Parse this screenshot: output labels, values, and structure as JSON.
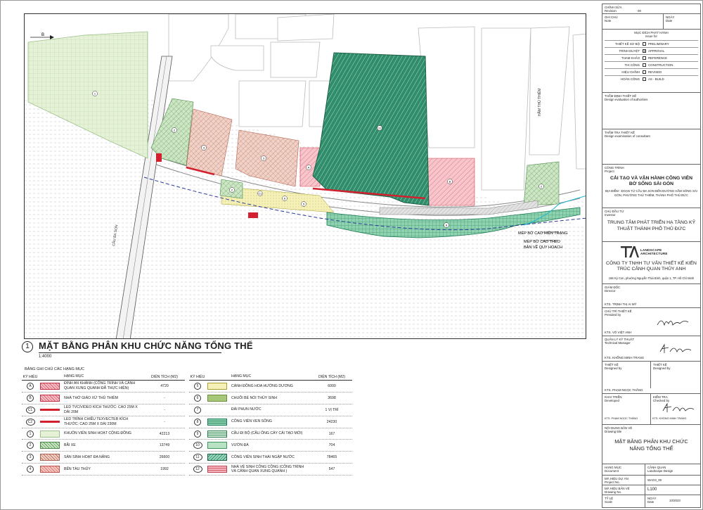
{
  "map": {
    "north_label": "B",
    "bridge_label": "CẦU BA SON",
    "street_label": "HẦM THỦ THIÊM",
    "callout_1": "MÉP BỜ CAO HIỆN TRẠNG",
    "callout_2": "MÉP BỜ CAO THEO BẢN VẼ QUY HOẠCH",
    "zone_numbers": [
      "1",
      "2",
      "3",
      "4",
      "5",
      "6",
      "7",
      "8",
      "9",
      "10",
      "11",
      "12",
      "A",
      "B"
    ]
  },
  "drawing_title": {
    "number": "1",
    "title": "MẶT BẰNG PHÂN KHU CHỨC NĂNG TỔNG THỂ",
    "scale": "1:4000"
  },
  "legend": {
    "title": "BẢNG GHI CHÚ CÁC HẠNG MỤC",
    "headers": {
      "symbol": "KÝ HIỆU",
      "item": "HẠNG MỤC",
      "area": "DIỆN TÍCH (M2)"
    },
    "left": [
      {
        "sym": "A",
        "name": "ĐÌNH AN KHÁNH (CÔNG TRÌNH VÀ CẢNH QUAN XUNG QUANH ĐÃ THỰC HIỆN)",
        "area": "4720",
        "swatch": "pink-hatch"
      },
      {
        "sym": "B",
        "name": "NHÀ THỜ GIÁO XỨ THỦ THIÊM",
        "area": "-",
        "swatch": "pink-hatch"
      },
      {
        "sym": "C1",
        "name": "LED TVC/VIDEO KÍCH THƯỚC: CAO 25M X DÀI 20M",
        "area": "-",
        "swatch": "red-bar"
      },
      {
        "sym": "C2",
        "name": "LED TRÌNH CHIẾU TEXVECTER KÍCH THƯỚC: CAO 25M X DÀI 230M",
        "area": "-",
        "swatch": "red-bar"
      },
      {
        "sym": "1",
        "name": "KHUÔN VIÊN SINH HOẠT CỘNG ĐỒNG",
        "area": "42213",
        "swatch": "light-green-grid"
      },
      {
        "sym": "2",
        "name": "BÃI XE",
        "area": "13749",
        "swatch": "green-hatch"
      },
      {
        "sym": "3",
        "name": "SÂN SINH HOẠT ĐA NĂNG",
        "area": "26600",
        "swatch": "brown-hatch"
      },
      {
        "sym": "4",
        "name": "BẾN TÀU THỦY",
        "area": "1992",
        "swatch": "salmon-hatch"
      }
    ],
    "right": [
      {
        "sym": "5",
        "name": "CÁNH ĐỒNG HOA HƯỚNG DƯƠNG",
        "area": "6000",
        "swatch": "yellow-dots"
      },
      {
        "sym": "6",
        "name": "CHUỖI BÈ NỔI THỦY SINH",
        "area": "3698",
        "swatch": "olive-green"
      },
      {
        "sym": "7",
        "name": "ĐÀI PHUN NƯỚC",
        "area": "1 VỊ TRÍ",
        "swatch": "none"
      },
      {
        "sym": "8",
        "name": "CÔNG VIÊN VEN SÔNG",
        "area": "24230",
        "swatch": "teal-grid"
      },
      {
        "sym": "9",
        "name": "CẦU ĐI BỘ (CẦU ỐNG CÂY CẢI TẠO MỚI)",
        "area": "167",
        "swatch": "green-lines"
      },
      {
        "sym": "10",
        "name": "VƯỜN ĐÁ",
        "area": "704",
        "swatch": "green-dots"
      },
      {
        "sym": "11",
        "name": "CÔNG VIÊN SINH THÁI NGẬP NƯỚC",
        "area": "78465",
        "swatch": "teal-hatch"
      },
      {
        "sym": "12",
        "name": "NHÀ VỆ SINH CÔNG CỘNG (CÔNG TRÌNH VÀ CẢNH QUAN XUNG QUANH )",
        "area": "547",
        "swatch": "pink-grid"
      }
    ]
  },
  "title_block": {
    "revision_vi": "CHỈNH SỬA",
    "revision_en": "Revision",
    "revision_no": "00",
    "note_vi": "GHI CHÚ",
    "note_en": "Note",
    "date_vi": "NGÀY",
    "date_en": "Date",
    "issue_vi": "MỤC ĐÍCH PHÁT HÀNH",
    "issue_en": "Issue for",
    "issue_rows": [
      {
        "vi": "THIẾT KẾ SƠ BỘ",
        "en": "PRELIMINARY",
        "checked": false
      },
      {
        "vi": "TRÌNH DUYỆT",
        "en": "APPROVAL",
        "checked": true
      },
      {
        "vi": "THAM KHẢO",
        "en": "REFERENCE",
        "checked": false
      },
      {
        "vi": "THI CÔNG",
        "en": "CONSTRUCTION",
        "checked": false
      },
      {
        "vi": "HIỆU CHỈNH",
        "en": "REVISED",
        "checked": false
      },
      {
        "vi": "HOÀN CÔNG",
        "en": "AS - BUILD",
        "checked": false
      }
    ],
    "appraisal_vi": "THẨM ĐỊNH THIẾT KẾ",
    "appraisal_en": "Design evaluation of authorities",
    "verification_vi": "THẨM TRA THIẾT KẾ",
    "verification_en": "Design examination of consultant",
    "project_vi": "CÔNG TRÌNH",
    "project_en": "Project",
    "project_name": "CẢI TẠO VÀ VẬN HÀNH CÔNG VIÊN BỜ SÔNG SÀI GÒN",
    "project_location": "ĐỊA ĐIỂM : ĐOẠN TỪ CẦU BA SON ĐẾN ĐƯỜNG HẦM SÔNG SÀI GÒN, PHƯỜNG THỦ THIÊM, THÀNH PHỐ THỦ ĐỨC",
    "investor_vi": "CHỦ ĐẦU TƯ",
    "investor_en": "Investor",
    "investor_name": "TRUNG TÂM PHÁT TRIỂN HẠ TẦNG KỸ THUẬT THÀNH PHỐ THỦ ĐỨC",
    "logo_text": "LANDSCAPE ARCHITECTURE",
    "company_name": "CÔNG TY TNHH TƯ VẤN THIẾT KẾ KIẾN TRÚC CẢNH QUAN THỦY ANH",
    "company_address": "166 Ký Con, phường Nguyễn Thái Bình, quận 1, TP. Hồ Chí Minh",
    "director_vi": "GIÁM ĐỐC",
    "director_en": "Director",
    "director_name": "KTS. TRỊNH THỊ AI MỸ",
    "chief_vi": "CHỦ TRÌ THIẾT KẾ",
    "chief_en": "Presided by",
    "chief_name": "KTS. VÕ VIỆT ANH",
    "tech_vi": "QUẢN LÝ KỸ THUẬT",
    "tech_en": "Technical Manager",
    "tech_name": "KTS. KHỔNG MINH TRANG",
    "design_vi": "THIẾT KẾ",
    "design_en": "Designed by",
    "design_name": "KTS. PHẠM NGỌC THẮNG",
    "developed_vi": "KHAI TRIỂN",
    "developed_en": "Developed",
    "developed_name": "KTS. PHẠM NGỌC THẮNG",
    "checked_vi": "KIỂM TRA",
    "checked_en": "Checked by",
    "checked_name": "KTS. KHỔNG MINH TRANG",
    "drawing_title_vi": "NỘI DUNG BẢN VẼ",
    "drawing_title_en": "Drawing title",
    "drawing_title_text": "MẶT BẰNG PHÂN KHU CHỨC NĂNG TỔNG THỂ",
    "document_vi": "HẠNG MỤC",
    "document_en": "Document",
    "document_value_vi": "CẢNH QUAN",
    "document_value_en": "Landscape Design",
    "project_no_vi": "MÃ HIỆU DỰ ÁN",
    "project_no_en": "Project No.",
    "project_no": "WAO3_00",
    "drawing_no_vi": "MÃ HIỆU BẢN VẼ",
    "drawing_no_en": "Drawing No.",
    "drawing_no": "L100",
    "scale_vi": "TỶ LỆ",
    "scale_en": "Scale",
    "date2_vi": "NGÀY",
    "date2_en": "Date",
    "date_value": "10/2023"
  }
}
